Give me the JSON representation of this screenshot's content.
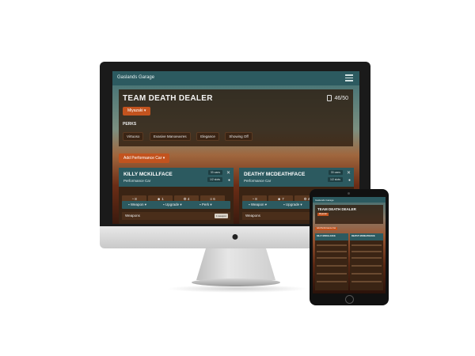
{
  "app": {
    "brand": "Gaslands Garage"
  },
  "team": {
    "name": "TEAM DEATH DEALER",
    "cans": "46/50",
    "sponsor": "Miyazaki",
    "perks_label": "PERKS",
    "perks": [
      "Virtuoso",
      "Evasive Manoeuvres",
      "Elegance",
      "Showing Off"
    ]
  },
  "actions": {
    "add_vehicle": "Add Performance Car"
  },
  "cars": [
    {
      "name": "KILLY MCKILLFACE",
      "type": "Performance Car",
      "cans": "33 cans",
      "slots": "1/2 slots",
      "stats": [
        "8",
        "1",
        "4",
        "6"
      ],
      "menu": [
        "Weapon",
        "Upgrade",
        "Perk"
      ],
      "weapons_label": "Weapons",
      "weapon_tag": "1 weapon"
    },
    {
      "name": "DEATHY MCDEATHFACE",
      "type": "Performance Car",
      "cans": "33 cans",
      "slots": "1/2 slots",
      "stats": [
        "8",
        "7",
        "4",
        "6"
      ],
      "menu": [
        "Weapon",
        "Upgrade",
        "Perk"
      ],
      "weapons_label": "Weapons",
      "weapon_tag": ""
    }
  ],
  "tablet": {
    "brand": "Gaslands Garage",
    "team_name": "TEAM DEATH DEALER",
    "sponsor": "Miyazaki",
    "add_vehicle": "Add Performance Car",
    "cars": [
      "KILLY MCKILLFACE",
      "DEATHY MCDEATHFACE"
    ]
  },
  "colors": {
    "accent": "#2c5a60",
    "brand": "#c2531e",
    "panel": "#3a2414"
  }
}
